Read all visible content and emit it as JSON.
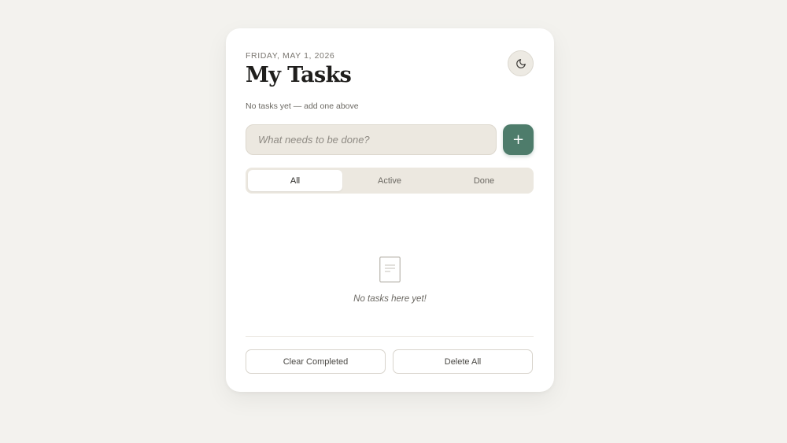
{
  "header": {
    "date": "FRIDAY, MAY 1, 2026",
    "title": "My Tasks",
    "theme_icon": "moon-icon"
  },
  "summary": "No tasks yet — add one above",
  "input": {
    "placeholder": "What needs to be done?",
    "value": "",
    "add_label": "+"
  },
  "tabs": [
    {
      "label": "All",
      "active": true
    },
    {
      "label": "Active",
      "active": false
    },
    {
      "label": "Done",
      "active": false
    }
  ],
  "empty_state": {
    "icon": "document-icon",
    "text": "No tasks here yet!"
  },
  "footer": {
    "clear_label": "Clear Completed",
    "delete_label": "Delete All"
  },
  "colors": {
    "accent": "#4e7c6b",
    "background": "#f3f2ee",
    "card": "#ffffff",
    "input": "#ece8e0"
  }
}
